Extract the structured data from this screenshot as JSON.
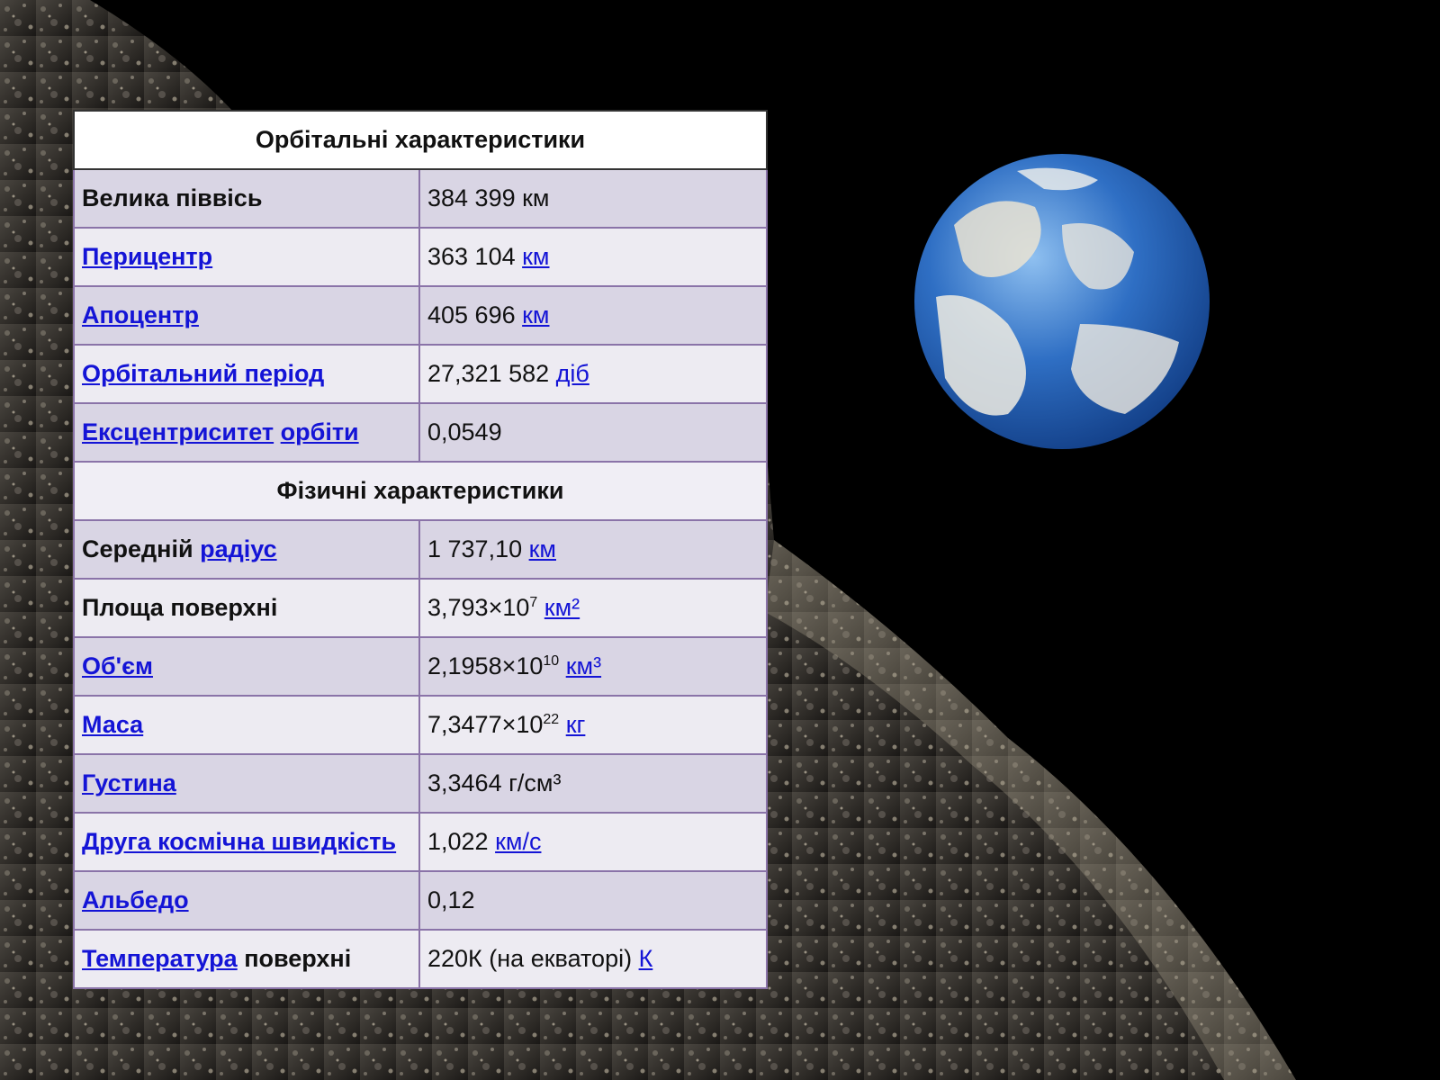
{
  "table": {
    "sections": [
      {
        "title": "Орбітальні характеристики",
        "rows": [
          {
            "label": [
              {
                "t": "Велика піввісь"
              }
            ],
            "value": [
              {
                "t": "384 399 км"
              }
            ]
          },
          {
            "label": [
              {
                "t": "Перицентр",
                "link": true
              }
            ],
            "value": [
              {
                "t": "363 104 "
              },
              {
                "t": "км",
                "link": true
              }
            ]
          },
          {
            "label": [
              {
                "t": "Апоцентр",
                "link": true
              }
            ],
            "value": [
              {
                "t": "405 696 "
              },
              {
                "t": "км",
                "link": true
              }
            ]
          },
          {
            "label": [
              {
                "t": "Орбітальний період",
                "link": true
              }
            ],
            "value": [
              {
                "t": "27,321 582 "
              },
              {
                "t": "діб",
                "link": true
              }
            ]
          },
          {
            "label": [
              {
                "t": "Ексцентриситет",
                "link": true
              },
              {
                "t": " "
              },
              {
                "t": "орбіти",
                "link": true
              }
            ],
            "value": [
              {
                "t": "0,0549"
              }
            ]
          }
        ]
      },
      {
        "title": "Фізичні характеристики",
        "rows": [
          {
            "label": [
              {
                "t": "Середній "
              },
              {
                "t": "радіус",
                "link": true
              }
            ],
            "value": [
              {
                "t": "1 737,10 "
              },
              {
                "t": "км",
                "link": true
              }
            ]
          },
          {
            "label": [
              {
                "t": "Площа поверхні"
              }
            ],
            "value": [
              {
                "t": "3,793×10"
              },
              {
                "t": "7",
                "sup": true
              },
              {
                "t": " "
              },
              {
                "t": "км²",
                "link": true
              }
            ]
          },
          {
            "label": [
              {
                "t": "Об'єм",
                "link": true
              }
            ],
            "value": [
              {
                "t": "2,1958×10"
              },
              {
                "t": "10",
                "sup": true
              },
              {
                "t": " "
              },
              {
                "t": "км³",
                "link": true
              }
            ]
          },
          {
            "label": [
              {
                "t": "Маса",
                "link": true
              }
            ],
            "value": [
              {
                "t": "7,3477×10"
              },
              {
                "t": "22",
                "sup": true
              },
              {
                "t": " "
              },
              {
                "t": "кг",
                "link": true
              }
            ]
          },
          {
            "label": [
              {
                "t": "Густина",
                "link": true
              }
            ],
            "value": [
              {
                "t": "3,3464 г/см³"
              }
            ]
          },
          {
            "label": [
              {
                "t": "Друга космічна швидкість",
                "link": true
              }
            ],
            "value": [
              {
                "t": "1,022 "
              },
              {
                "t": "км/с",
                "link": true
              }
            ]
          },
          {
            "label": [
              {
                "t": "Альбедо",
                "link": true
              }
            ],
            "value": [
              {
                "t": "0,12"
              }
            ]
          },
          {
            "label": [
              {
                "t": "Температура",
                "link": true
              },
              {
                "t": " поверхні"
              }
            ],
            "value": [
              {
                "t": "220К (на екваторі) "
              },
              {
                "t": "К",
                "link": true
              }
            ]
          }
        ]
      }
    ]
  },
  "colors": {
    "link": "#1414d6",
    "row_even": "#d9d5e4",
    "row_odd": "#edebf2",
    "border": "#8a73a8"
  }
}
